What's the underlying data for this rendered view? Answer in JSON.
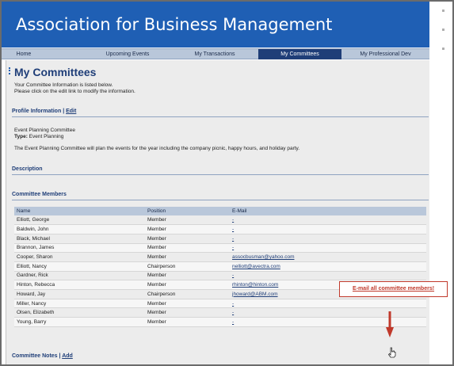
{
  "header": {
    "title": "Association for Business Management"
  },
  "nav": [
    {
      "label": "Home",
      "active": false
    },
    {
      "label": "Upcoming Events",
      "active": false
    },
    {
      "label": "My Transactions",
      "active": false
    },
    {
      "label": "My Committees",
      "active": true
    },
    {
      "label": "My Professional Dev",
      "active": false
    }
  ],
  "page": {
    "title": "My Committees",
    "intro_line1": "Your Committee Information is listed below.",
    "intro_line2": "Please click on the edit link to modify the information."
  },
  "profile": {
    "heading": "Profile Information",
    "separator": "|",
    "edit_label": "Edit",
    "committee_name": "Event Planning Committee",
    "type_label": "Type:",
    "type_value": "Event Planning",
    "summary": "The Event Planning Committee will plan the events for the year including the company picnic, happy hours, and holiday party."
  },
  "description": {
    "heading": "Description"
  },
  "members": {
    "heading": "Committee Members",
    "columns": [
      "Name",
      "Position",
      "E-Mail"
    ],
    "rows": [
      {
        "name": "Elliott, George",
        "position": "Member",
        "email": "-"
      },
      {
        "name": "Baldwin, John",
        "position": "Member",
        "email": "-"
      },
      {
        "name": "Black, Michael",
        "position": "Member",
        "email": "-"
      },
      {
        "name": "Brannon, James",
        "position": "Member",
        "email": "-"
      },
      {
        "name": "Cooper, Sharon",
        "position": "Member",
        "email": "assocbusman@yahoo.com"
      },
      {
        "name": "Elliott, Nancy",
        "position": "Chairperson",
        "email": "nelliott@avectra.com"
      },
      {
        "name": "Gardner, Rick",
        "position": "Member",
        "email": "-"
      },
      {
        "name": "Hinton, Rebecca",
        "position": "Member",
        "email": "rhinton@hinton.com"
      },
      {
        "name": "Howard, Jay",
        "position": "Chairperson",
        "email": "jhoward@ABM.com"
      },
      {
        "name": "Miller, Nancy",
        "position": "Member",
        "email": "-"
      },
      {
        "name": "Olsen, Elizabeth",
        "position": "Member",
        "email": "-"
      },
      {
        "name": "Young, Barry",
        "position": "Member",
        "email": "-"
      }
    ]
  },
  "actions": {
    "email_all_label": "E-mail all committee members!"
  },
  "notes": {
    "heading": "Committee Notes",
    "separator": "|",
    "add_label": "Add"
  },
  "colors": {
    "header": "#1f5fb4",
    "nav": "#b9c7da",
    "nav_active": "#1f3e78",
    "highlight": "#c0392b"
  },
  "icons": {
    "arrow": "red-arrow-down-icon",
    "cursor": "hand-pointer-icon"
  }
}
